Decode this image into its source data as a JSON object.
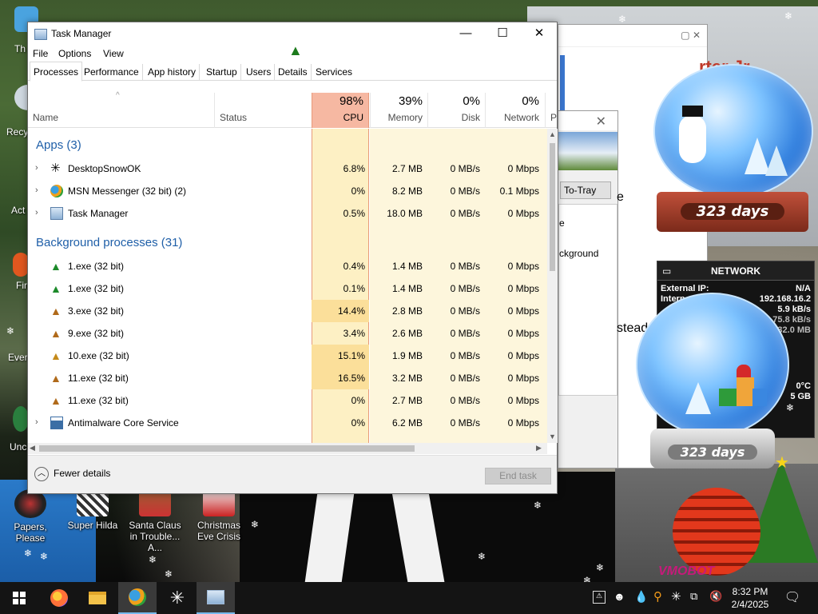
{
  "desktop": {
    "icons": [
      {
        "label": "Th"
      },
      {
        "label": "Recy"
      },
      {
        "label": "Act"
      },
      {
        "label": "Fir"
      },
      {
        "label": "Ever"
      },
      {
        "label": "Unc"
      }
    ],
    "bottom_icons": [
      {
        "label": "Papers, Please"
      },
      {
        "label": "Super Hilda"
      },
      {
        "label": "Santa Claus in Trouble... A..."
      },
      {
        "label": "Christmas Eve Crisis"
      }
    ],
    "bg_window_text": "rter Jr.",
    "bg_window2": {
      "button": "To-Tray",
      "text1": "e",
      "text2": "ckground"
    },
    "bg_text_e": "e",
    "bg_text_stead": "stead"
  },
  "gadgets": {
    "globe1_days": "323 days",
    "globe2_days": "323 days",
    "network": {
      "title": "NETWORK",
      "external_ip_label": "External IP:",
      "external_ip_value": "N/A",
      "internal_label": "Intern",
      "internal_value": "192.168.16.2",
      "down_value": "5.9 kB/s",
      "up_value": "75.8 kB/s",
      "total_value": "32.0 MB",
      "temp_value": "0°C",
      "size_value": "5 GB"
    },
    "vinyl_text": "VMOBOT"
  },
  "task_manager": {
    "title": "Task Manager",
    "controls": {
      "minimize": "—",
      "maximize": "☐",
      "close": "✕"
    },
    "menu": [
      "File",
      "Options",
      "View"
    ],
    "tabs": [
      "Processes",
      "Performance",
      "App history",
      "Startup",
      "Users",
      "Details",
      "Services"
    ],
    "active_tab": "Processes",
    "columns": {
      "name": "Name",
      "status": "Status",
      "cpu_pct": "98%",
      "cpu": "CPU",
      "mem_pct": "39%",
      "mem": "Memory",
      "disk_pct": "0%",
      "disk": "Disk",
      "net_pct": "0%",
      "net": "Network",
      "power": "P"
    },
    "groups": {
      "apps": "Apps (3)",
      "background": "Background processes (31)"
    },
    "apps": [
      {
        "name": "DesktopSnowOK",
        "cpu": "6.8%",
        "mem": "2.7 MB",
        "disk": "0 MB/s",
        "net": "0 Mbps"
      },
      {
        "name": "MSN Messenger (32 bit) (2)",
        "cpu": "0%",
        "mem": "8.2 MB",
        "disk": "0 MB/s",
        "net": "0.1 Mbps"
      },
      {
        "name": "Task Manager",
        "cpu": "0.5%",
        "mem": "18.0 MB",
        "disk": "0 MB/s",
        "net": "0 Mbps"
      }
    ],
    "background": [
      {
        "name": "1.exe (32 bit)",
        "cpu": "0.4%",
        "mem": "1.4 MB",
        "disk": "0 MB/s",
        "net": "0 Mbps"
      },
      {
        "name": "1.exe (32 bit)",
        "cpu": "0.1%",
        "mem": "1.4 MB",
        "disk": "0 MB/s",
        "net": "0 Mbps"
      },
      {
        "name": "3.exe (32 bit)",
        "cpu": "14.4%",
        "mem": "2.8 MB",
        "disk": "0 MB/s",
        "net": "0 Mbps"
      },
      {
        "name": "9.exe (32 bit)",
        "cpu": "3.4%",
        "mem": "2.6 MB",
        "disk": "0 MB/s",
        "net": "0 Mbps"
      },
      {
        "name": "10.exe (32 bit)",
        "cpu": "15.1%",
        "mem": "1.9 MB",
        "disk": "0 MB/s",
        "net": "0 Mbps"
      },
      {
        "name": "11.exe (32 bit)",
        "cpu": "16.5%",
        "mem": "3.2 MB",
        "disk": "0 MB/s",
        "net": "0 Mbps"
      },
      {
        "name": "11.exe (32 bit)",
        "cpu": "0%",
        "mem": "2.7 MB",
        "disk": "0 MB/s",
        "net": "0 Mbps"
      },
      {
        "name": "Antimalware Core Service",
        "cpu": "0%",
        "mem": "6.2 MB",
        "disk": "0 MB/s",
        "net": "0 Mbps"
      }
    ],
    "footer": {
      "fewer_details": "Fewer details",
      "end_task": "End task"
    }
  },
  "taskbar": {
    "clock_time": "8:32 PM",
    "clock_date": "2/4/2025"
  },
  "colors": {
    "cpu_header": "#f6b8a2",
    "cpu_col": "#fbe3a6",
    "other_col": "#fdf4d4",
    "group_blue": "#1f5fa8"
  }
}
